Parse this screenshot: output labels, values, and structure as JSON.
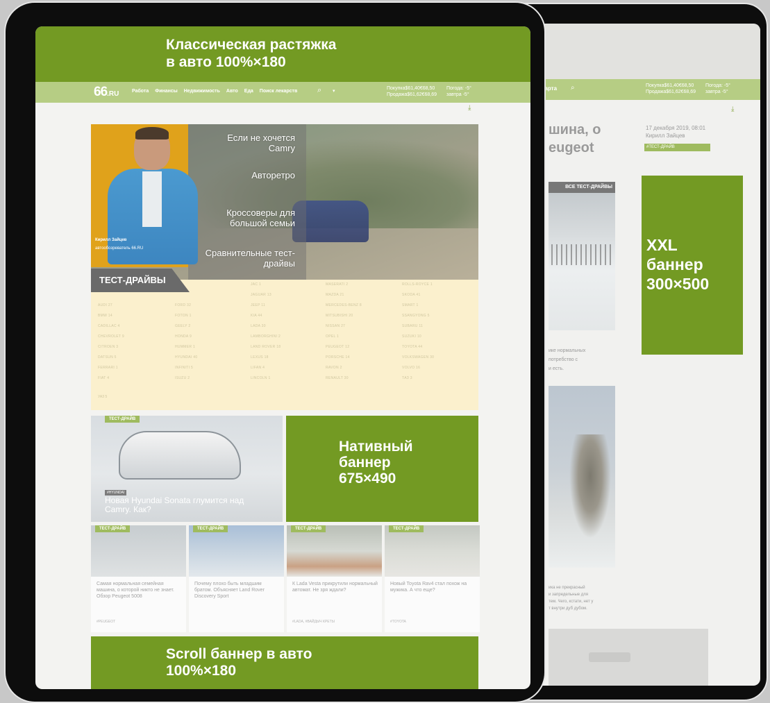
{
  "back": {
    "ghost_links": [
      "",
      "",
      ""
    ],
    "nav_link": "еарта",
    "rates": "Покупка$61,40€68,50\nПродажа$61,62€68,69",
    "weather": "Погода: -5°\nзавтра -5°",
    "title": "шина, о\neugeot",
    "meta": "17 декабря 2019, 08:01\nКирилл Зайцев",
    "tag": "#ТЕСТ-ДРАЙВ",
    "photo_label": "ВСЕ ТЕСТ-ДРАЙВЫ",
    "text1": "ике нормальных\nпотребство с\nи есть.",
    "text2": "ика не прекрасный\nи запредельные для\nтем. Чего, кстати, нет у\nт внутри дуб дубом.",
    "xxl_banner": "XXL\nбаннер\n300×500"
  },
  "front": {
    "top_banner": "Классическая растяжка\nв авто 100%×180",
    "logo": "66",
    "logo_suffix": ".RU",
    "nav_items": [
      "Работа",
      "Финансы",
      "Недвижимость",
      "Авто",
      "Еда",
      "Поиск лекарств"
    ],
    "rates": "Покупка$61,40€68,50\nПродажа$61,62€68,69",
    "weather": "Погода: -5°\nзавтра -5°",
    "hero": {
      "person_name": "Кирилл Зайцев",
      "person_role": "автообозреватель 66.RU",
      "menu": [
        "Если не хочется\nCamry",
        "Авторетро",
        "Кроссоверы для\nбольшой семьи",
        "Сравнительные тест-\nдрайвы"
      ],
      "tab_label": "ТЕСТ-ДРАЙВЫ"
    },
    "brands": {
      "col1": [
        "AUDI 27",
        "BMW 14",
        "CADILLAC 4",
        "CHEVROLET 9",
        "CITROEN 3",
        "DATSUN 5",
        "FERRARI 1",
        "FIAT 4"
      ],
      "col2": [
        "FORD 32",
        "FOTON 1",
        "GEELY 2",
        "HONDA 9",
        "HUMMER 1",
        "HYUNDAI 40",
        "INFINITI 5",
        "ISUZU 2"
      ],
      "col3": [
        "JAC 1",
        "JAGUAR 13",
        "JEEP 11",
        "KIA 44",
        "LADA 30",
        "LAMBORGHINI 2",
        "LAND ROVER 18",
        "LEXUS 18",
        "LIFAN 4",
        "LINCOLN 1"
      ],
      "col4": [
        "MASERATI 2",
        "MAZDA 21",
        "MERCEDES-BENZ 8",
        "MITSUBISHI 20",
        "NISSAN 27",
        "OPEL 1",
        "PEUGEOT 12",
        "PORSCHE 14",
        "RAVON 2",
        "RENAULT 30"
      ],
      "col5": [
        "ROLLS-ROYCE 1",
        "SKODA 41",
        "SMART 1",
        "SSANGYONG 5",
        "SUBARU 11",
        "SUZUKI 10",
        "TOYOTA 44",
        "VOLKSWAGEN 30",
        "VOLVO 16",
        "ТАЗ 3"
      ],
      "extra": "УАЗ 5"
    },
    "big_card": {
      "tag": "ТЕСТ-ДРАЙВ",
      "brand": "#HYUNDAI",
      "title": "Новая Hyundai Sonata глумится над Camry. Как?"
    },
    "native_banner": "Нативный\nбаннер\n675×490",
    "small_cards": [
      {
        "tag": "ТЕСТ-ДРАЙВ",
        "title": "Самая нормальная семейная машина, о которой никто не знает. Обзор Peugeot 5008",
        "footer": "#PEUGEOT"
      },
      {
        "tag": "ТЕСТ-ДРАЙВ",
        "title": "Почему плохо быть младшим братом. Объясняет Land Rover Discovery Sport",
        "footer": ""
      },
      {
        "tag": "ТЕСТ-ДРАЙВ",
        "title": "К Lada Vesta прикрутили нормальный автомат. Не зря ждали?",
        "footer": "#LADA, #ВАЙДЫЧ КРЕТЫ"
      },
      {
        "tag": "ТЕСТ-ДРАЙВ",
        "title": "Новый Toyota Rav4 стал похож на мужика. А что еще?",
        "footer": "#TOYOTA"
      }
    ],
    "scroll_banner": "Scroll баннер в авто\n100%×180"
  },
  "colors": {
    "banner_green": "#739a23",
    "nav_green": "#b6cd84",
    "hero_yellow": "#fbf0cd",
    "person_bg": "#e0a21b"
  }
}
